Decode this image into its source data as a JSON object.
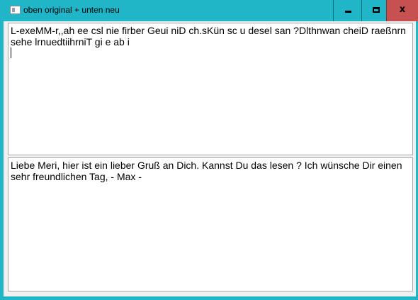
{
  "window": {
    "title": "oben original + unten neu",
    "controls": {
      "minimize_icon": "minimize-icon",
      "maximize_icon": "maximize-icon",
      "close_glyph": "x",
      "close_color": "#c75050"
    },
    "frame_color": "#20b6c8"
  },
  "top_box": {
    "text": "L-exeMM-r,,ah ee csl nie firber Geui  niD ch.sKün sc  u desel san ?Dlthnwan cheiD raeßnrn sehe lrnuedtiihrniT gi e  ab i"
  },
  "bottom_box": {
    "text": "Liebe Meri, hier ist ein lieber Gruß an Dich. Kannst Du das lesen ? Ich wünsche Dir einen sehr freundlichen Tag, - Max -"
  }
}
